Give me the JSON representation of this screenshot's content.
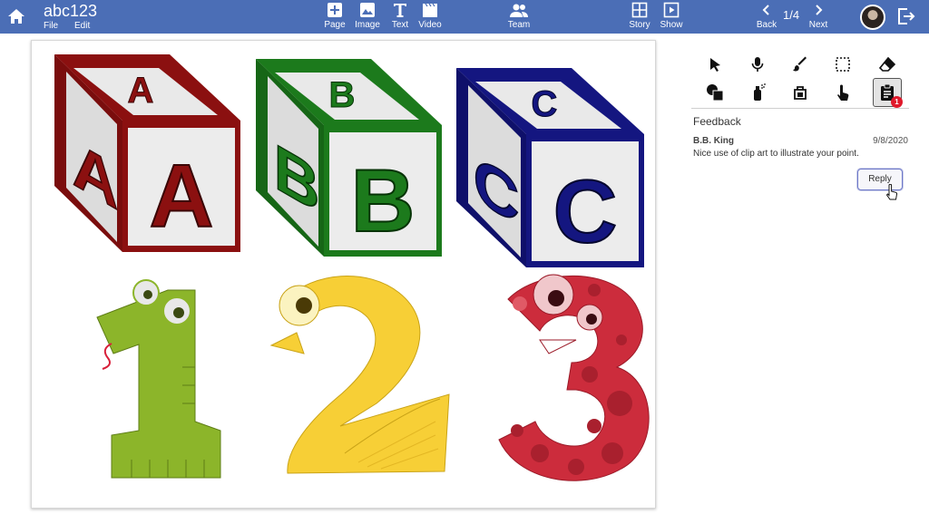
{
  "header": {
    "doc_title": "abc123",
    "menu": {
      "file": "File",
      "edit": "Edit"
    },
    "tools": {
      "page": "Page",
      "image": "Image",
      "text": "Text",
      "video": "Video",
      "team": "Team",
      "story": "Story",
      "show": "Show",
      "back": "Back",
      "next": "Next"
    },
    "page_indicator": "1/4",
    "icons": [
      "home-icon",
      "add-page-icon",
      "image-icon",
      "text-icon",
      "video-icon",
      "team-icon",
      "story-icon",
      "show-icon",
      "chevron-left-icon",
      "chevron-right-icon",
      "avatar",
      "logout-icon"
    ],
    "colors": {
      "bar": "#4b6eb6"
    }
  },
  "canvas": {
    "blocks": [
      {
        "letter": "A",
        "color": "#8b1010"
      },
      {
        "letter": "B",
        "color": "#1c7a1c"
      },
      {
        "letter": "C",
        "color": "#141680"
      }
    ],
    "numbers": [
      {
        "digit": "1",
        "color": "#8cb52a"
      },
      {
        "digit": "2",
        "color": "#f7cf36"
      },
      {
        "digit": "3",
        "color": "#cc2c3c"
      }
    ]
  },
  "sidebar": {
    "tool_icons": [
      "pointer-icon",
      "microphone-icon",
      "brush-icon",
      "select-rect-icon",
      "eraser-icon",
      "shapes-icon",
      "spray-icon",
      "fill-bucket-icon",
      "touch-icon",
      "clipboard-icon"
    ],
    "badge_count": "1",
    "feedback": {
      "title": "Feedback",
      "author": "B.B. King",
      "date": "9/8/2020",
      "text": "Nice use of clip art to illustrate your point.",
      "reply_label": "Reply"
    }
  }
}
